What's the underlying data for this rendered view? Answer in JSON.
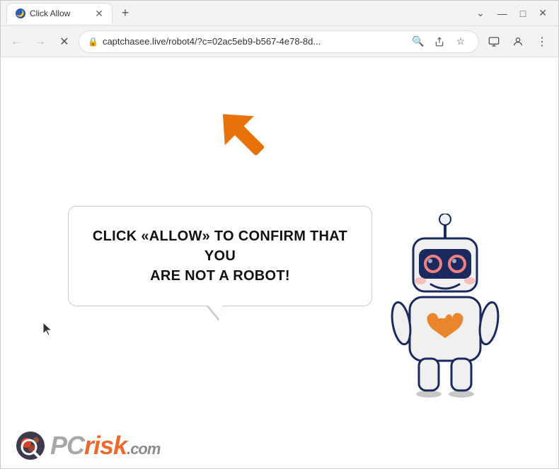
{
  "browser": {
    "tab": {
      "title": "Click Allow",
      "icon": "moon-icon"
    },
    "new_tab_label": "+",
    "window_controls": {
      "minimize": "—",
      "maximize": "□",
      "close": "✕",
      "chevron": "⌄"
    },
    "nav": {
      "back": "←",
      "forward": "→",
      "reload": "✕"
    },
    "url": {
      "lock_icon": "🔒",
      "text": "captchasee.live/robot4/?c=02ac5eb9-b567-4e78-8d..."
    }
  },
  "page": {
    "bubble_text_line1": "CLICK «ALLOW» TO CONFIRM THAT YOU",
    "bubble_text_line2": "ARE NOT A ROBOT!"
  },
  "watermark": {
    "text_pc": "PC",
    "text_risk": "risk",
    "text_com": ".com"
  }
}
